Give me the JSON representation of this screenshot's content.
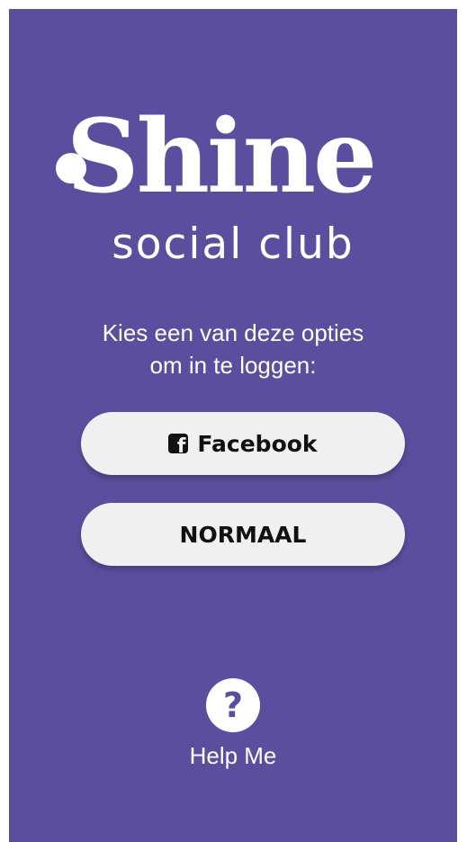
{
  "colors": {
    "background": "#5b4e9e",
    "button_bg": "#f1f0f0",
    "button_text": "#111111",
    "text": "#ffffff"
  },
  "logo": {
    "title": "Shine",
    "subtitle": "social club"
  },
  "login": {
    "prompt_line1": "Kies een van deze opties",
    "prompt_line2": "om in te loggen:",
    "facebook_label": "Facebook",
    "facebook_icon": "facebook-icon",
    "normal_label": "NORMAAL"
  },
  "help": {
    "icon": "question-icon",
    "label": "Help Me"
  }
}
